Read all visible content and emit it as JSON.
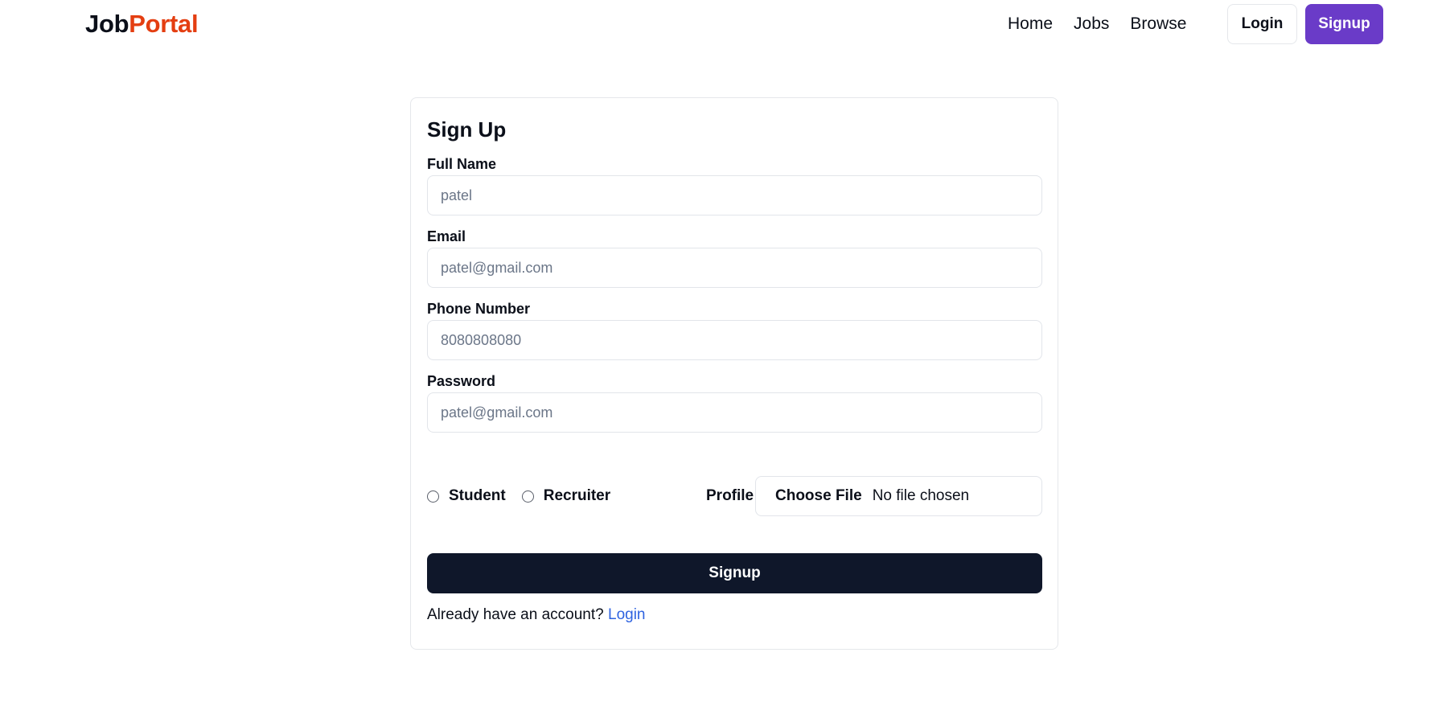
{
  "navbar": {
    "logo_part_1": "Job",
    "logo_part_2": "Portal",
    "links": [
      "Home",
      "Jobs",
      "Browse"
    ],
    "login_label": "Login",
    "signup_label": "Signup"
  },
  "form": {
    "title": "Sign Up",
    "full_name": {
      "label": "Full Name",
      "placeholder": "patel",
      "value": ""
    },
    "email": {
      "label": "Email",
      "placeholder": "patel@gmail.com",
      "value": ""
    },
    "phone": {
      "label": "Phone Number",
      "placeholder": "8080808080",
      "value": ""
    },
    "password": {
      "label": "Password",
      "placeholder": "patel@gmail.com",
      "value": ""
    },
    "roles": [
      "Student",
      "Recruiter"
    ],
    "profile": {
      "label": "Profile",
      "button_label": "Choose File",
      "status": "No file chosen"
    },
    "submit_label": "Signup",
    "footer_text": "Already have an account? ",
    "footer_link": "Login"
  },
  "colors": {
    "brand_accent": "#e43e11",
    "signup_button": "#6a3bc8",
    "submit_button": "#0f172a",
    "link": "#2f63e0"
  }
}
